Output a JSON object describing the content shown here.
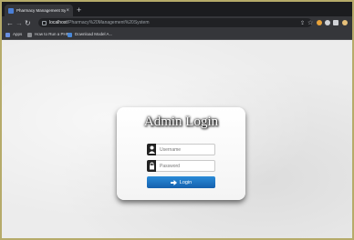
{
  "browser": {
    "tab_title": "Pharmacy Management System",
    "tab_close": "×",
    "new_tab": "+",
    "url_host": "localhost",
    "url_path": "/Pharmacy%20Management%20System",
    "bookmarks": [
      {
        "label": "Apps",
        "icon": "apps-grid-icon"
      },
      {
        "label": "How to Run a PHP...",
        "icon": "bookmark-icon"
      },
      {
        "label": "Download Model A...",
        "icon": "bookmark-icon"
      }
    ]
  },
  "login": {
    "title": "Admin Login",
    "username_placeholder": "Username",
    "password_placeholder": "Password",
    "button_label": "Login"
  },
  "colors": {
    "accent": "#1f7bd0",
    "frame": "#b6ab6a"
  }
}
